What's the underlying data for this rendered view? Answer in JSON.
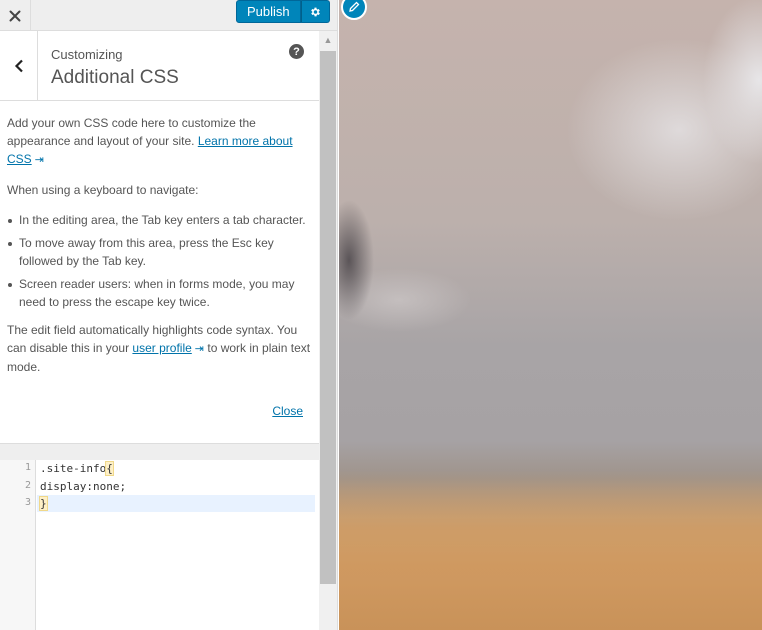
{
  "header": {
    "close_icon": "close-icon",
    "publish_label": "Publish",
    "settings_icon": "gear-icon"
  },
  "section": {
    "customizing_label": "Customizing",
    "title": "Additional CSS",
    "help_icon": "help-icon",
    "help_glyph": "?"
  },
  "description": {
    "intro": "Add your own CSS code here to customize the appearance and layout of your site.",
    "learn_more_link": "Learn more about CSS",
    "keyboard_heading": "When using a keyboard to navigate:",
    "bullets": [
      "In the editing area, the Tab key enters a tab character.",
      "To move away from this area, press the Esc key followed by the Tab key.",
      "Screen reader users: when in forms mode, you may need to press the escape key twice."
    ],
    "syntax_before": "The edit field automatically highlights code syntax. You can disable this in your",
    "user_profile_link": "user profile",
    "syntax_after": "to work in plain text mode.",
    "close_link": "Close"
  },
  "editor": {
    "lines": [
      {
        "number": "1",
        "selector": ".site-info",
        "brace": "{"
      },
      {
        "number": "2",
        "property": "display",
        "colon": ":",
        "value": "none",
        "semi": ";"
      },
      {
        "number": "3",
        "brace": "}"
      }
    ],
    "active_line": 3
  },
  "colors": {
    "accent": "#0085ba",
    "link": "#0073aa",
    "sidebar_bg": "#eeeeee"
  }
}
